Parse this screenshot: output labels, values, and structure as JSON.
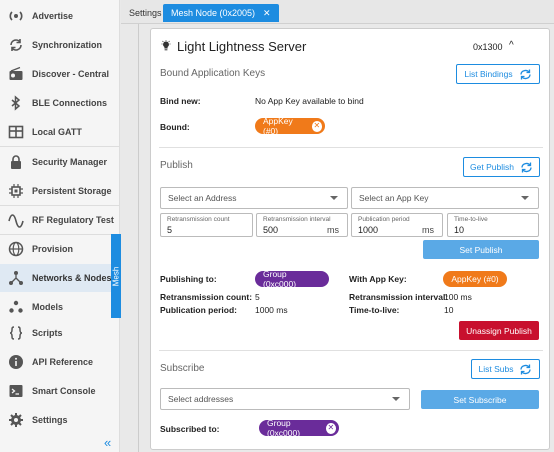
{
  "sidebar": {
    "items": [
      {
        "label": "Advertise",
        "icon": "broadcast-icon"
      },
      {
        "label": "Synchronization",
        "icon": "sync-icon"
      },
      {
        "label": "Discover - Central",
        "icon": "radio-icon"
      },
      {
        "label": "BLE Connections",
        "icon": "bluetooth-icon"
      },
      {
        "label": "Local GATT",
        "icon": "table-icon"
      },
      {
        "label": "Security Manager",
        "icon": "lock-icon"
      },
      {
        "label": "Persistent Storage",
        "icon": "chip-icon"
      },
      {
        "label": "RF Regulatory Test",
        "icon": "wave-icon"
      },
      {
        "label": "Provision",
        "icon": "globe-icon"
      },
      {
        "label": "Networks & Nodes",
        "icon": "network-icon"
      },
      {
        "label": "Models",
        "icon": "models-icon"
      },
      {
        "label": "Scripts",
        "icon": "braces-icon"
      },
      {
        "label": "API Reference",
        "icon": "info-icon"
      },
      {
        "label": "Smart Console",
        "icon": "console-icon"
      },
      {
        "label": "Settings",
        "icon": "gear-icon"
      }
    ],
    "mesh_tab": "Mesh",
    "collapse_glyph": "«"
  },
  "tabs": {
    "settings": "Settings",
    "mesh_node": "Mesh Node (0x2005)",
    "close_glyph": "✕"
  },
  "server": {
    "title": "Light Lightness Server",
    "code": "0x1300",
    "collapse_glyph": "^"
  },
  "bound": {
    "heading": "Bound Application Keys",
    "list_bindings": "List Bindings",
    "bind_new_label": "Bind new:",
    "bind_new_value": "No App Key available to bind",
    "bound_label": "Bound:",
    "bound_chip": "AppKey (#0)"
  },
  "publish": {
    "heading": "Publish",
    "get_publish": "Get Publish",
    "address_placeholder": "Select an Address",
    "appkey_placeholder": "Select an App Key",
    "fields": [
      {
        "label": "Retransmission count",
        "value": "5",
        "unit": ""
      },
      {
        "label": "Retransmission interval",
        "value": "500",
        "unit": "ms"
      },
      {
        "label": "Publication period",
        "value": "1000",
        "unit": "ms"
      },
      {
        "label": "Time-to-live",
        "value": "10",
        "unit": ""
      }
    ],
    "set_publish": "Set Publish",
    "publishing_to_label": "Publishing to:",
    "publishing_to_chip": "Group (0xc000)",
    "with_app_key_label": "With App Key:",
    "with_app_key_chip": "AppKey (#0)",
    "retrans_count_label": "Retransmission count:",
    "retrans_count_value": "5",
    "retrans_interval_label": "Retransmission interval:",
    "retrans_interval_value": "100 ms",
    "pub_period_label": "Publication period:",
    "pub_period_value": "1000 ms",
    "ttl_label": "Time-to-live:",
    "ttl_value": "10",
    "unassign": "Unassign Publish"
  },
  "subscribe": {
    "heading": "Subscribe",
    "list_subs": "List Subs",
    "addresses_placeholder": "Select addresses",
    "set_subscribe": "Set Subscribe",
    "subscribed_label": "Subscribed to:",
    "subscribed_chip": "Group (0xc000)"
  },
  "colors": {
    "accent": "#1d8ce0",
    "orange": "#f07a1a",
    "purple": "#6a2c9a",
    "danger": "#c8102e"
  }
}
